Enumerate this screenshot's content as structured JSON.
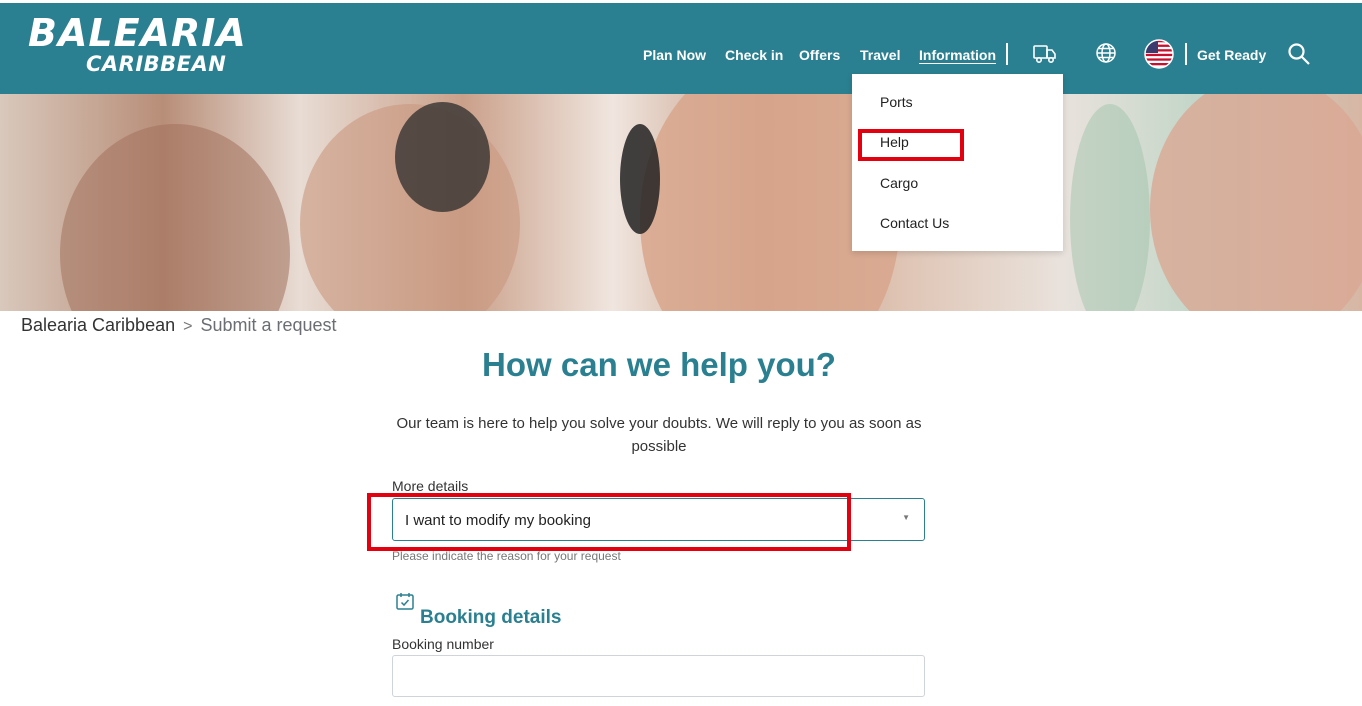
{
  "header": {
    "logo_line1": "BALEARIA",
    "logo_line2": "CARIBBEAN",
    "nav": [
      {
        "label": "Plan Now"
      },
      {
        "label": "Check in"
      },
      {
        "label": "Offers"
      },
      {
        "label": "Travel"
      },
      {
        "label": "Information"
      }
    ],
    "get_ready": "Get Ready",
    "icons": [
      "truck-icon",
      "globe-icon",
      "us-flag-icon",
      "search-icon"
    ]
  },
  "dropdown": {
    "items": [
      {
        "label": "Ports"
      },
      {
        "label": "Help"
      },
      {
        "label": "Cargo"
      },
      {
        "label": "Contact Us"
      }
    ]
  },
  "breadcrumb": {
    "home": "Balearia Caribbean",
    "separator": ">",
    "current": "Submit a request"
  },
  "page": {
    "title": "How can we help you?",
    "intro": "Our team is here to help you solve your doubts. We will reply to you as soon as possible"
  },
  "form": {
    "more_details_label": "More details",
    "more_details_value": "I want to modify my booking",
    "more_details_hint": "Please indicate the reason for your request",
    "booking_section_title": "Booking details",
    "booking_number_label": "Booking number",
    "booking_number_value": ""
  },
  "colors": {
    "brand": "#2a8091",
    "highlight": "#e3000f"
  }
}
